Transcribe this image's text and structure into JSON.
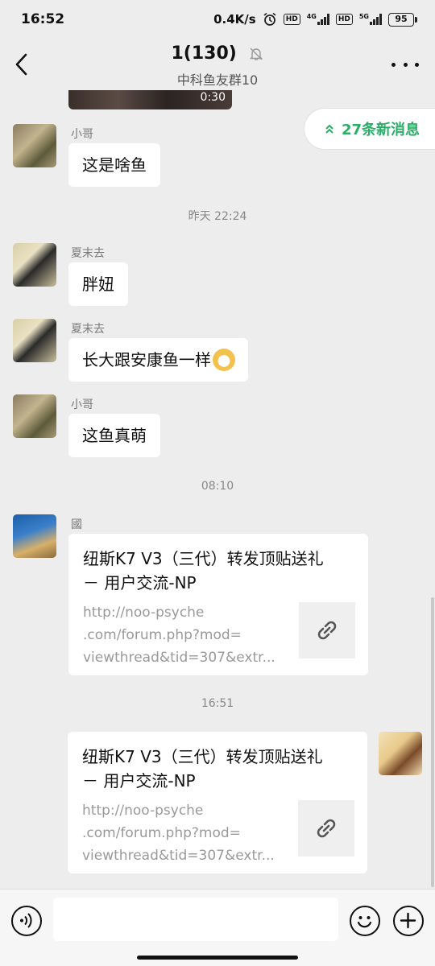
{
  "status_bar": {
    "time": "16:52",
    "net_speed": "0.4K/s",
    "hd1": "HD",
    "net1": "4G",
    "hd2": "HD",
    "net2": "5G",
    "battery": "95"
  },
  "header": {
    "title": "1(130)",
    "subtitle": "中科鱼友群10"
  },
  "video": {
    "duration": "0:30"
  },
  "new_messages_label": "27条新消息",
  "messages": [
    {
      "sender": "小哥",
      "text": "这是啥鱼"
    },
    {
      "timestamp": "昨天 22:24"
    },
    {
      "sender": "夏末去",
      "text": "胖妞"
    },
    {
      "sender": "夏末去",
      "text": "长大跟安康鱼一样",
      "emoji": "cat-emoji"
    },
    {
      "sender": "小哥",
      "text": "这鱼真萌"
    },
    {
      "timestamp": "08:10"
    },
    {
      "sender": "國",
      "link": {
        "title_line1": "纽斯K7 V3（三代）转发顶贴送礼",
        "title_line2": "－ 用户交流-NP",
        "url_line1": "http://noo-psyche",
        "url_line2": ".com/forum.php?mod=",
        "url_line3": "viewthread&tid=307&extr..."
      }
    },
    {
      "timestamp": "16:51"
    },
    {
      "sender": "",
      "self": true,
      "link": {
        "title_line1": "纽斯K7 V3（三代）转发顶贴送礼",
        "title_line2": "－ 用户交流-NP",
        "url_line1": "http://noo-psyche",
        "url_line2": ".com/forum.php?mod=",
        "url_line3": "viewthread&tid=307&extr..."
      }
    }
  ],
  "input": {
    "placeholder": ""
  },
  "colors": {
    "accent": "#2aae67",
    "background": "#ededed",
    "bubble": "#ffffff"
  }
}
